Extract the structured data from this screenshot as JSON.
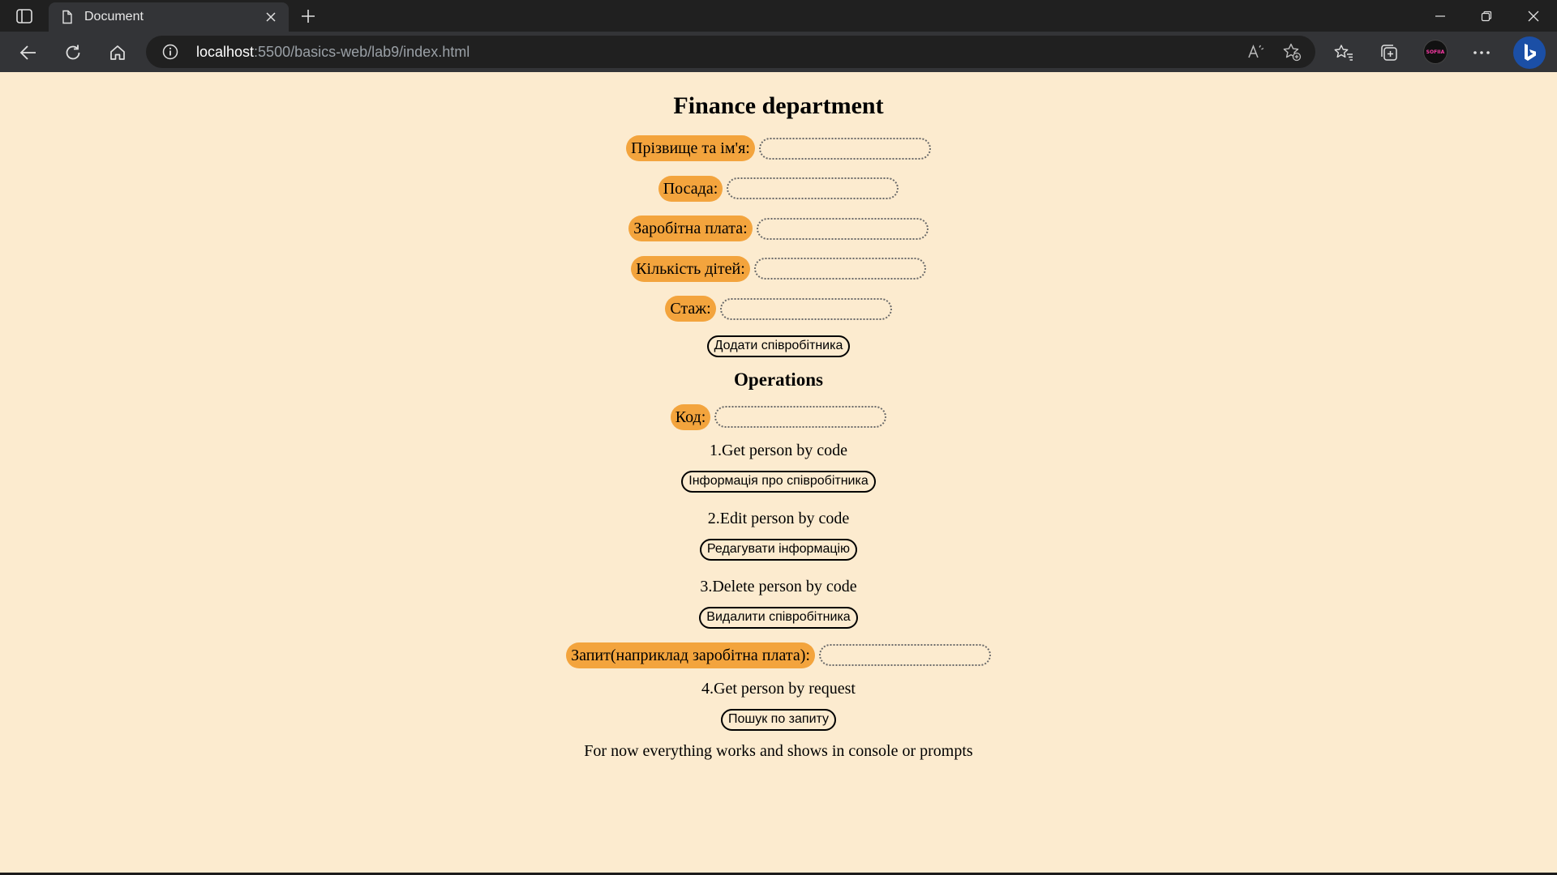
{
  "browser": {
    "tab_title": "Document",
    "url_host": "localhost",
    "url_rest": ":5500/basics-web/lab9/index.html",
    "profile_label": "SOFIIA",
    "accent_color": "#1b4fa6"
  },
  "page": {
    "title": "Finance department",
    "background_color": "#fcebcf",
    "label_color": "#f3a43d",
    "fields": [
      {
        "label": "Прізвище та ім'я:",
        "value": ""
      },
      {
        "label": "Посада:",
        "value": ""
      },
      {
        "label": "Заробітна плата:",
        "value": ""
      },
      {
        "label": "Кількість дітей:",
        "value": ""
      },
      {
        "label": "Стаж:",
        "value": ""
      }
    ],
    "add_button": "Додати співробітника",
    "operations_title": "Operations",
    "code_label": "Код:",
    "op1_text": "1.Get person by code",
    "op1_button": "Інформація про співробітника",
    "op2_text": "2.Edit person by code",
    "op2_button": "Редагувати інформацію",
    "op3_text": "3.Delete person by code",
    "op3_button": "Видалити співробітника",
    "request_label": "Запит(наприклад заробітна плата):",
    "op4_text": "4.Get person by request",
    "op4_button": "Пошук по запиту",
    "footer": "For now everything works and shows in console or prompts"
  }
}
